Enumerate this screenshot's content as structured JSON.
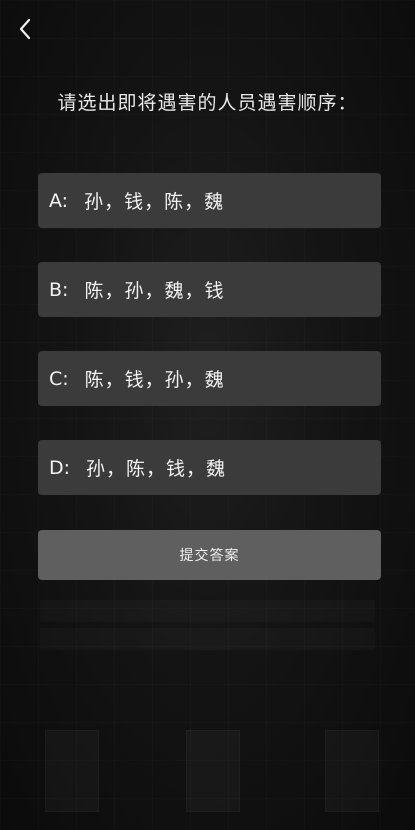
{
  "nav": {
    "back_icon": "chevron-left-icon"
  },
  "question": {
    "text": "请选出即将遇害的人员遇害顺序："
  },
  "options": [
    {
      "letter": "A:",
      "text": "孙，钱，陈，魏"
    },
    {
      "letter": "B:",
      "text": "陈，孙，魏，钱"
    },
    {
      "letter": "C:",
      "text": "陈，钱，孙，魏"
    },
    {
      "letter": "D:",
      "text": "孙，陈，钱，魏"
    }
  ],
  "submit": {
    "label": "提交答案"
  },
  "colors": {
    "background": "#141414",
    "option_bg": "#3b3b3b",
    "submit_bg": "#5f5f5f",
    "text": "#f2f2f2"
  }
}
